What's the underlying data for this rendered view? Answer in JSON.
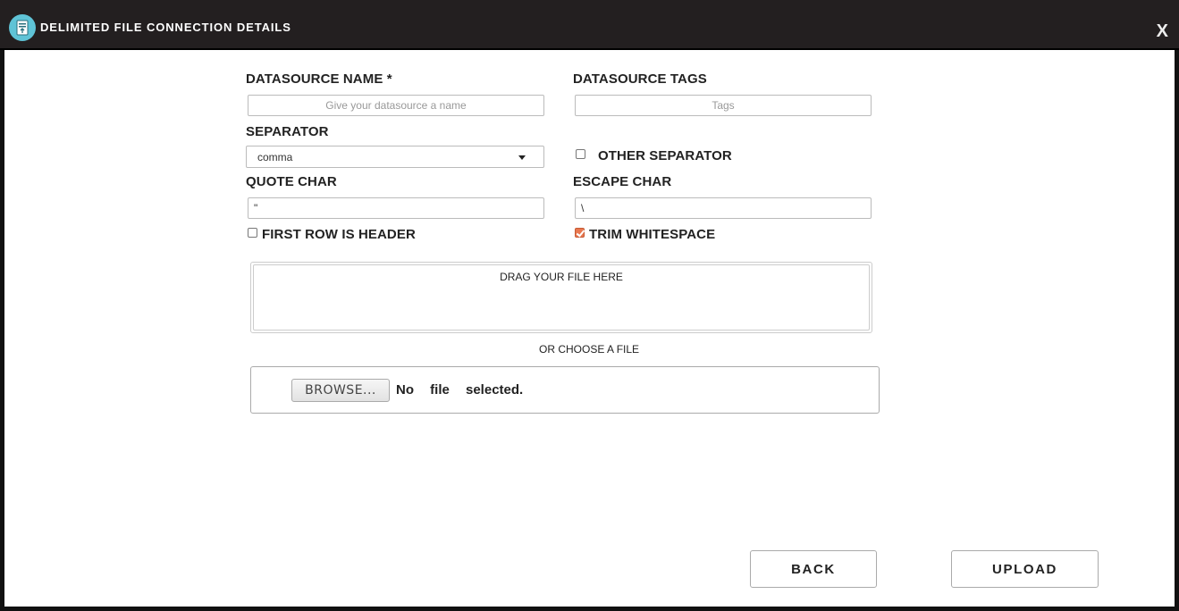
{
  "window": {
    "title": "DELIMITED FILE CONNECTION DETAILS",
    "close_label": "X",
    "icon": "file-upload-icon"
  },
  "form": {
    "datasource_name": {
      "label": "DATASOURCE NAME *",
      "placeholder": "Give your datasource a name",
      "value": ""
    },
    "datasource_tags": {
      "label": "DATASOURCE TAGS",
      "placeholder": "Tags",
      "value": ""
    },
    "separator": {
      "label": "SEPARATOR",
      "selected": "comma"
    },
    "other_separator": {
      "label": "OTHER SEPARATOR",
      "checked": false
    },
    "quote_char": {
      "label": "QUOTE CHAR",
      "value": "\""
    },
    "escape_char": {
      "label": "ESCAPE CHAR",
      "value": "\\"
    },
    "first_row_header": {
      "label": "FIRST ROW IS HEADER",
      "checked": false
    },
    "trim_whitespace": {
      "label": "TRIM WHITESPACE",
      "checked": true
    }
  },
  "upload": {
    "dropzone_text": "DRAG YOUR FILE HERE",
    "or_text": "OR CHOOSE A FILE",
    "browse_label": "BROWSE...",
    "no_file_text": "No file selected."
  },
  "actions": {
    "back_label": "BACK",
    "upload_label": "UPLOAD"
  },
  "colors": {
    "titlebar": "#231f20",
    "icon_bg": "#5fc3d6",
    "checkbox_accent": "#e8774f"
  }
}
